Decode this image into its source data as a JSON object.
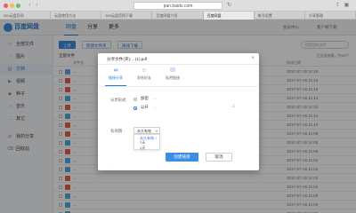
{
  "browser": {
    "url": "pan.baidu.com",
    "tabs": [
      {
        "label": "360云盘官网"
      },
      {
        "label": "云盘使用方法"
      },
      {
        "label": "360云盘官网下载"
      },
      {
        "label": "百度网盘介绍"
      },
      {
        "label": "百度网盘"
      },
      {
        "label": "帐号设置"
      },
      {
        "label": "分享管理"
      }
    ],
    "active_tab": 4
  },
  "app": {
    "logo_text": "百度网盘",
    "nav": [
      "网盘",
      "分享",
      "更多"
    ],
    "header_links": [
      "会员中心",
      "客户端下载"
    ]
  },
  "sidebar": {
    "items": [
      {
        "label": "全部文件",
        "icon": "folder-icon"
      },
      {
        "label": "图片",
        "icon": "image-icon"
      },
      {
        "label": "文档",
        "icon": "doc-icon"
      },
      {
        "label": "视频",
        "icon": "video-icon"
      },
      {
        "label": "种子",
        "icon": "torrent-icon"
      },
      {
        "label": "音乐",
        "icon": "music-icon"
      },
      {
        "label": "其它",
        "icon": "other-icon"
      },
      {
        "label": "我的分享",
        "icon": "share-icon"
      },
      {
        "label": "回收站",
        "icon": "trash-icon"
      }
    ],
    "active": 2
  },
  "toolbar": {
    "upload_label": "上传",
    "new_folder_label": "新建文件夹",
    "offline_label": "离线下载",
    "search_placeholder": "搜索您的文件"
  },
  "list": {
    "breadcrumb": "全部文件",
    "count_text": "已全部加载，共46个",
    "columns": [
      "文件名",
      "大小",
      "修改日期"
    ],
    "rows": [
      {
        "name": "…",
        "size": "",
        "date": "2017-07-19 11:18",
        "color": "#6aa5e6"
      },
      {
        "name": "…",
        "size": "",
        "date": "2017-07-19 11:16",
        "color": "#e45f4b"
      },
      {
        "name": "…",
        "size": "",
        "date": "2017-07-19 11:16",
        "color": "#e45f4b"
      },
      {
        "name": "…",
        "size": "",
        "date": "2017-07-19 11:14",
        "color": "#4fa8e0"
      },
      {
        "name": "…",
        "size": "",
        "date": "2017-07-19 11:14",
        "color": "#e45f4b"
      },
      {
        "name": "…",
        "size": "",
        "date": "2017-07-19 11:12",
        "color": "#4fa8e0"
      },
      {
        "name": "…",
        "size": "",
        "date": "2017-07-19 11:10",
        "color": "#e45f4b"
      },
      {
        "name": "…",
        "size": "",
        "date": "2017-07-19 11:08",
        "color": "#e45f4b"
      },
      {
        "name": "…",
        "size": "",
        "date": "2017-07-19 11:08",
        "color": "#4fa8e0"
      },
      {
        "name": "…",
        "size": "",
        "date": "2017-07-19 11:06",
        "color": "#e45f4b"
      },
      {
        "name": "…",
        "size": "",
        "date": "2017-07-19 11:04",
        "color": "#4fa8e0"
      },
      {
        "name": "…",
        "size": "",
        "date": "2017-07-19 11:04",
        "color": "#4fa8e0"
      },
      {
        "name": "…",
        "size": "",
        "date": "2017-07-19 11:02",
        "color": "#e45f4b"
      },
      {
        "name": "…",
        "size": "",
        "date": "2017-07-19 11:02",
        "color": "#e45f4b"
      },
      {
        "name": "…",
        "size": "",
        "date": "2017-07-19 11:00",
        "color": "#4fa8e0"
      },
      {
        "name": "…",
        "size": "",
        "date": "2017-07-19 11:00",
        "color": "#4fa8e0"
      },
      {
        "name": "…",
        "size": "",
        "date": "2017-07-19 11:00",
        "color": "#4fa8e0"
      }
    ]
  },
  "modal": {
    "title": "分享文件(夹):…(1).pdf",
    "close_icon": "close-icon",
    "tabs": [
      {
        "label": "链接分享",
        "icon": "link-icon"
      },
      {
        "label": "发给好友",
        "icon": "friend-icon"
      },
      {
        "label": "私密链接",
        "icon": "lock-icon"
      }
    ],
    "active_tab": 0,
    "share_form_label": "分享形式",
    "option_public": {
      "label": "加密",
      "desc": "…"
    },
    "option_private": {
      "label": "公开",
      "desc": "…"
    },
    "validity_label": "有效期",
    "validity_selected": "永久有效",
    "validity_options": [
      "永久有效",
      "7天",
      "1天"
    ],
    "create_button": "创建链接",
    "cancel_button": "取消",
    "footnote": "…"
  },
  "colors": {
    "accent": "#2b79d6",
    "primary_button": "#3b8ee3",
    "warning": "#e05a4a"
  }
}
